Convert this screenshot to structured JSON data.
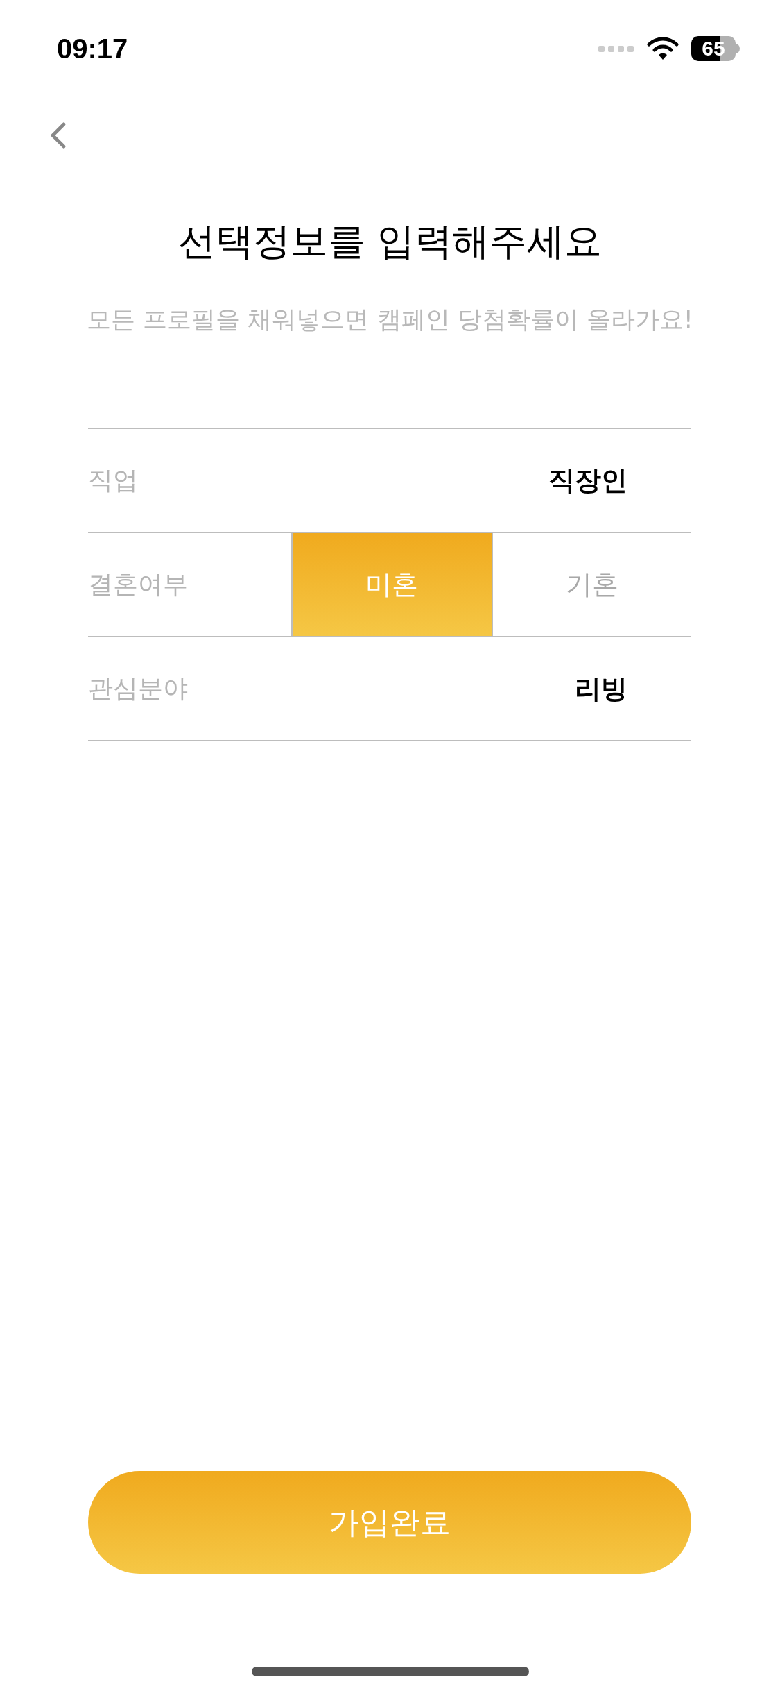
{
  "status_bar": {
    "time": "09:17",
    "battery": "65"
  },
  "title": "선택정보를 입력해주세요",
  "subtitle": "모든 프로필을 채워넣으면 캠페인 당첨확률이 올라가요!",
  "rows": [
    {
      "kind": "value",
      "label": "직업",
      "value": "직장인"
    },
    {
      "kind": "segmented",
      "label": "결혼여부",
      "options": [
        {
          "label": "미혼",
          "selected": true
        },
        {
          "label": "기혼",
          "selected": false
        }
      ]
    },
    {
      "kind": "value",
      "label": "관심분야",
      "value": "리빙"
    }
  ],
  "submit": "가입완료"
}
